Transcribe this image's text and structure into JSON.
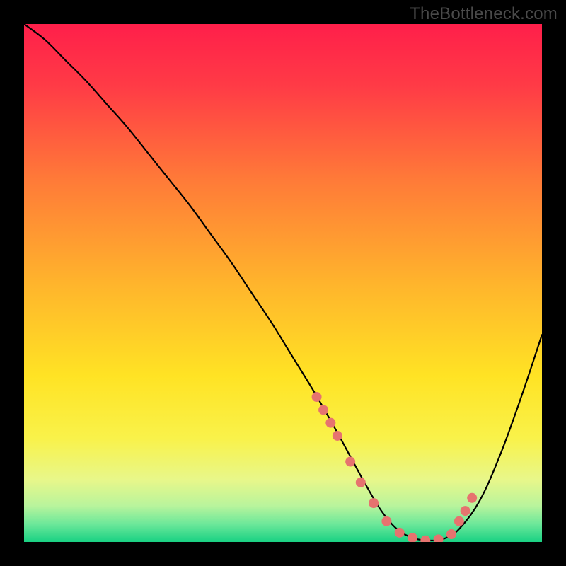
{
  "watermark": "TheBottleneck.com",
  "chart_data": {
    "type": "line",
    "title": "",
    "xlabel": "",
    "ylabel": "",
    "xlim": [
      0,
      100
    ],
    "ylim": [
      0,
      100
    ],
    "background_gradient": {
      "stops": [
        {
          "offset": 0.0,
          "color": "#ff1f4a"
        },
        {
          "offset": 0.12,
          "color": "#ff3b46"
        },
        {
          "offset": 0.3,
          "color": "#ff7a38"
        },
        {
          "offset": 0.5,
          "color": "#ffb42c"
        },
        {
          "offset": 0.68,
          "color": "#ffe324"
        },
        {
          "offset": 0.8,
          "color": "#f9f24a"
        },
        {
          "offset": 0.88,
          "color": "#e8f78a"
        },
        {
          "offset": 0.93,
          "color": "#b9f49c"
        },
        {
          "offset": 0.965,
          "color": "#6de89a"
        },
        {
          "offset": 1.0,
          "color": "#19d183"
        }
      ]
    },
    "curve": {
      "x": [
        0,
        4,
        8,
        12,
        16,
        20,
        24,
        28,
        32,
        36,
        40,
        44,
        48,
        52,
        56,
        60,
        63,
        66,
        69,
        72,
        75,
        78,
        81,
        84,
        88,
        92,
        96,
        100
      ],
      "y": [
        100,
        97,
        93,
        89,
        84.5,
        80,
        75,
        70,
        65,
        59.5,
        54,
        48,
        42,
        35.5,
        29,
        22,
        16.5,
        11,
        6,
        2.5,
        0.8,
        0.3,
        0.6,
        2.5,
        8,
        17,
        28,
        40
      ]
    },
    "markers": {
      "x": [
        56.5,
        57.8,
        59.2,
        60.5,
        63.0,
        65.0,
        67.5,
        70.0,
        72.5,
        75.0,
        77.5,
        80.0,
        82.5,
        84.0,
        85.2,
        86.5
      ],
      "y": [
        28.0,
        25.5,
        23.0,
        20.5,
        15.5,
        11.5,
        7.5,
        4.0,
        1.8,
        0.8,
        0.3,
        0.5,
        1.5,
        4.0,
        6.0,
        8.5
      ],
      "color": "#e6736f",
      "radius": 7
    }
  }
}
